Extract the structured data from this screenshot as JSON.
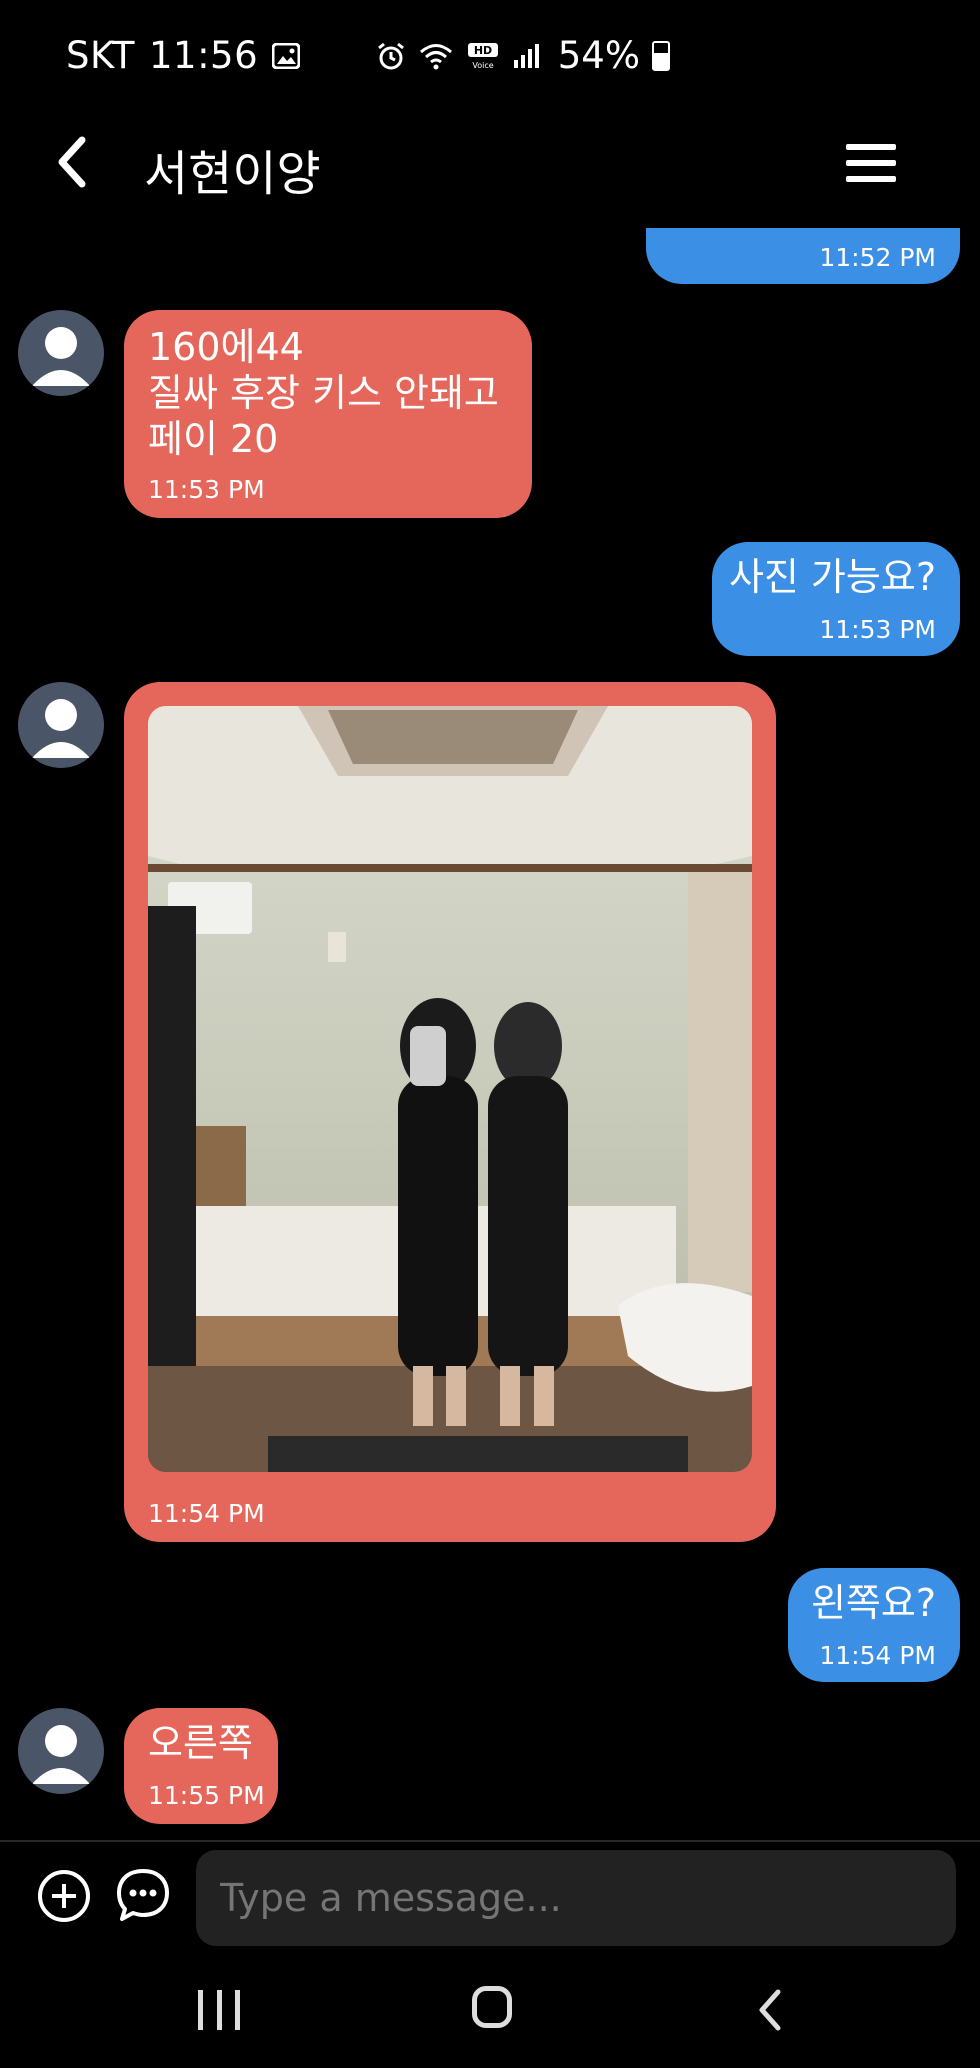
{
  "status_bar": {
    "carrier": "SKT",
    "time": "11:56",
    "battery_percent": "54%",
    "icons": [
      "gallery-icon",
      "alarm-icon",
      "wifi-icon",
      "hd-voice-icon",
      "signal-icon",
      "battery-icon"
    ]
  },
  "header": {
    "title": "서현이양",
    "back_icon": "chevron-left-icon",
    "menu_icon": "hamburger-menu-icon"
  },
  "messages": [
    {
      "direction": "out",
      "text": "",
      "time": "11:52 PM"
    },
    {
      "direction": "in",
      "text": "160에44\n질싸 후장 키스 안돼고\n페이 20",
      "time": "11:53 PM"
    },
    {
      "direction": "out",
      "text": "사진 가능요?",
      "time": "11:53 PM"
    },
    {
      "direction": "in",
      "type": "photo",
      "text": "",
      "time": "11:54 PM"
    },
    {
      "direction": "out",
      "text": "왼쪽요?",
      "time": "11:54 PM"
    },
    {
      "direction": "in",
      "text": "오른쪽",
      "time": "11:55 PM"
    }
  ],
  "composer": {
    "placeholder": "Type a message...",
    "attach_icon": "plus-circle-icon",
    "more_icon": "chat-bubble-dots-icon"
  },
  "colors": {
    "incoming_bubble": "#e5675b",
    "outgoing_bubble": "#3b8fe4",
    "background": "#000000"
  }
}
